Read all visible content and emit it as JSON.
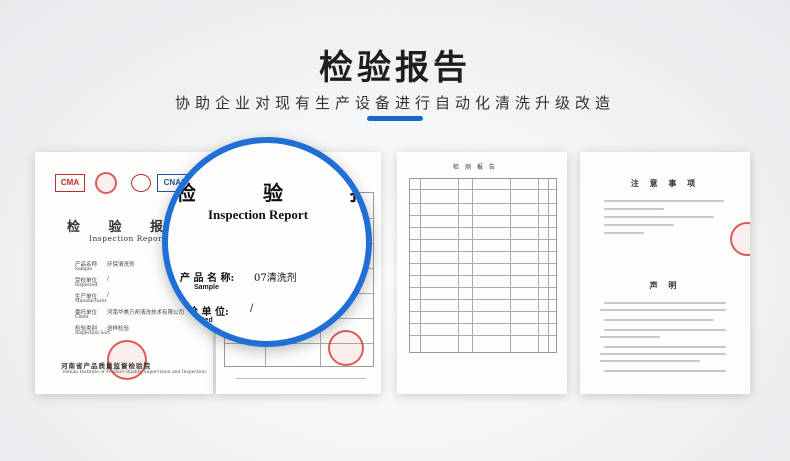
{
  "header": {
    "title": "检验报告",
    "subtitle": "协助企业对现有生产设备进行自动化清洗升级改造"
  },
  "accent_color": "#1a66c9",
  "report1": {
    "logos": [
      "CMA",
      "CNAS"
    ],
    "title": "检 验 报",
    "title_en": "Inspection Report",
    "rows": [
      {
        "label": "产品名称",
        "value": "环保清洗剂"
      },
      {
        "label": "Sample",
        "value": ""
      },
      {
        "label": "受检单位",
        "value": "/"
      },
      {
        "label": "Inspected",
        "value": ""
      },
      {
        "label": "生产单位",
        "value": "/"
      },
      {
        "label": "Manufacturer",
        "value": ""
      },
      {
        "label": "委托单位",
        "value": "河南华美万邦清洗技术有限公司"
      },
      {
        "label": "Client",
        "value": ""
      },
      {
        "label": "检验类别",
        "value": "送样检验"
      },
      {
        "label": "Inspection Sort",
        "value": ""
      }
    ],
    "footer_cn": "河南省产品质量监督检验院",
    "footer_en": "Henan Institute of Product Quality Supervision and Inspection"
  },
  "magnifier": {
    "heading": "检 验 报",
    "heading_en": "Inspection Report",
    "product_label": "产 品 名 称:",
    "product_value": "07清洗剂",
    "sample": "Sample",
    "unit_label": "检 单 位:",
    "unit_value": "/",
    "inspected": "nspected"
  },
  "report3": {
    "title": "检 测 报 告"
  },
  "report4": {
    "title": "注 意 事 项",
    "title2": "声   明"
  }
}
